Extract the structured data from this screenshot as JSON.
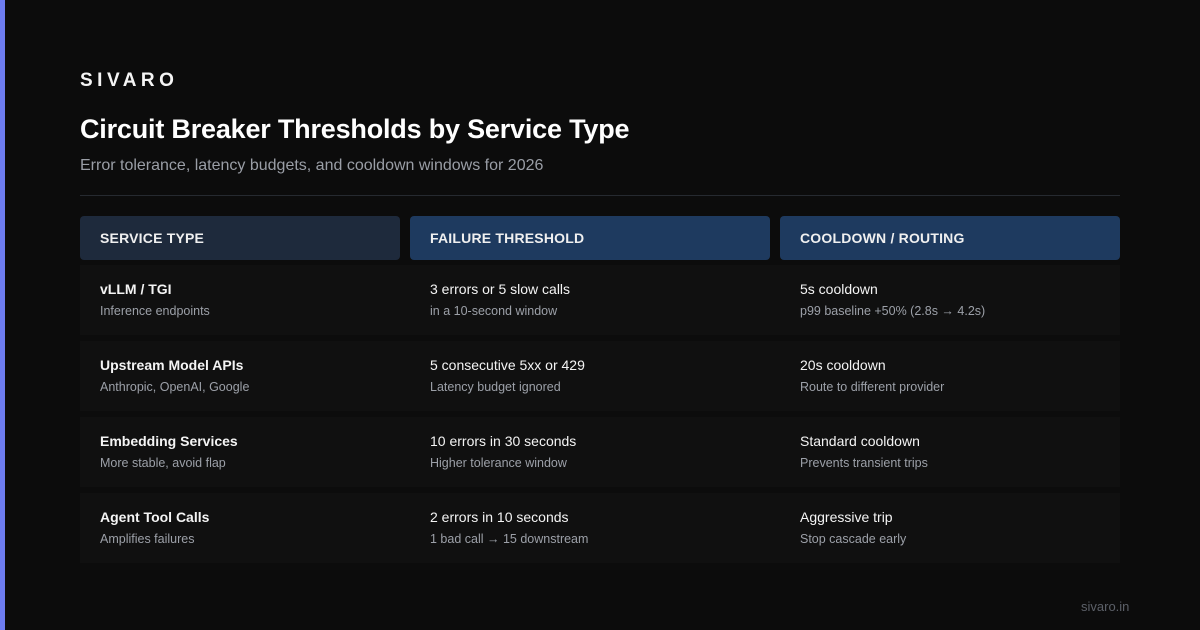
{
  "brand": "SIVARO",
  "title": "Circuit Breaker Thresholds by Service Type",
  "subtitle": "Error tolerance, latency budgets, and cooldown windows for 2026",
  "headers": [
    "SERVICE TYPE",
    "FAILURE THRESHOLD",
    "COOLDOWN / ROUTING"
  ],
  "rows": [
    {
      "service": "vLLM / TGI",
      "service_note": "Inference endpoints",
      "threshold": "3 errors or 5 slow calls",
      "threshold_note": "in a 10-second window",
      "cooldown": "5s cooldown",
      "cooldown_note": "p99 baseline +50% (2.8s → 4.2s)"
    },
    {
      "service": "Upstream Model APIs",
      "service_note": "Anthropic, OpenAI, Google",
      "threshold": "5 consecutive 5xx or 429",
      "threshold_note": "Latency budget ignored",
      "cooldown": "20s cooldown",
      "cooldown_note": "Route to different provider"
    },
    {
      "service": "Embedding Services",
      "service_note": "More stable, avoid flap",
      "threshold": "10 errors in 30 seconds",
      "threshold_note": "Higher tolerance window",
      "cooldown": "Standard cooldown",
      "cooldown_note": "Prevents transient trips"
    },
    {
      "service": "Agent Tool Calls",
      "service_note": "Amplifies failures",
      "threshold": "2 errors in 10 seconds",
      "threshold_note": "1 bad call → 15 downstream",
      "cooldown": "Aggressive trip",
      "cooldown_note": "Stop cascade early"
    }
  ],
  "footer": "sivaro.in",
  "colors": {
    "background": "#0c0c0c",
    "accent": "#6d7cf0",
    "header_first": "#1e2a3c",
    "header": "#1e3a5f",
    "row": "#101010"
  }
}
